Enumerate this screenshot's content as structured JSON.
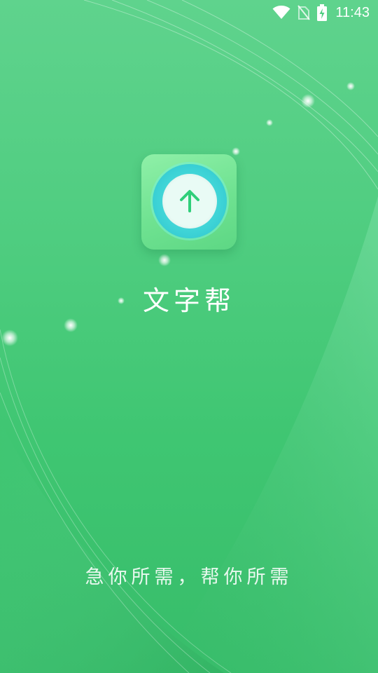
{
  "status_bar": {
    "time": "11:43",
    "icons": [
      "wifi-icon",
      "no-sim-icon",
      "battery-charging-icon"
    ]
  },
  "app": {
    "name": "文字帮",
    "icon": "upload-arrow-icon",
    "slogan": "急你所需，帮你所需"
  },
  "colors": {
    "background_top": "#5fd38d",
    "background_bottom": "#37bd6a",
    "icon_tile": "#7de79c",
    "icon_ring": "#3dd3d6",
    "arrow": "#2fcf7a",
    "text": "#ffffff"
  }
}
